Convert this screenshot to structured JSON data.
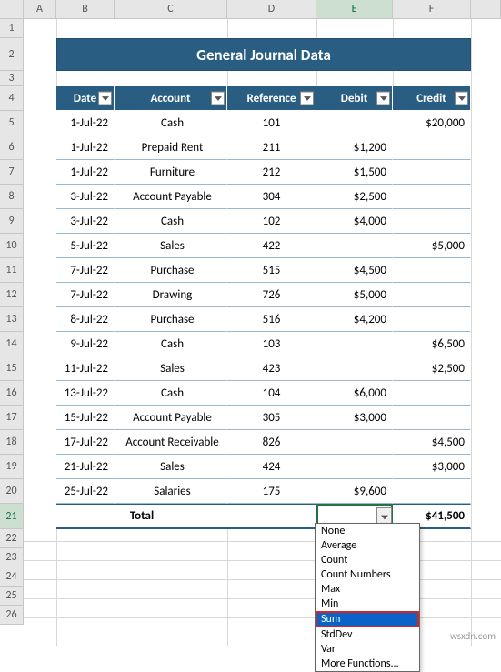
{
  "columns": [
    "",
    "A",
    "B",
    "C",
    "D",
    "E",
    "F",
    ""
  ],
  "active_column": "E",
  "rows": [
    "1",
    "2",
    "3",
    "4",
    "5",
    "6",
    "7",
    "8",
    "9",
    "10",
    "11",
    "12",
    "13",
    "14",
    "15",
    "16",
    "17",
    "18",
    "19",
    "20",
    "21",
    "22",
    "23",
    "24",
    "25",
    "26"
  ],
  "active_row": "21",
  "title": "General Journal Data",
  "headers": {
    "date": "Date",
    "account": "Account",
    "reference": "Reference",
    "debit": "Debit",
    "credit": "Credit"
  },
  "data": [
    {
      "date": "1-Jul-22",
      "account": "Cash",
      "reference": "101",
      "debit": "",
      "credit": "$20,000"
    },
    {
      "date": "1-Jul-22",
      "account": "Prepaid Rent",
      "reference": "211",
      "debit": "$1,200",
      "credit": ""
    },
    {
      "date": "1-Jul-22",
      "account": "Furniture",
      "reference": "212",
      "debit": "$1,500",
      "credit": ""
    },
    {
      "date": "3-Jul-22",
      "account": "Account Payable",
      "reference": "304",
      "debit": "$2,500",
      "credit": ""
    },
    {
      "date": "3-Jul-22",
      "account": "Cash",
      "reference": "102",
      "debit": "$4,000",
      "credit": ""
    },
    {
      "date": "5-Jul-22",
      "account": "Sales",
      "reference": "422",
      "debit": "",
      "credit": "$5,000"
    },
    {
      "date": "7-Jul-22",
      "account": "Purchase",
      "reference": "515",
      "debit": "$4,500",
      "credit": ""
    },
    {
      "date": "7-Jul-22",
      "account": "Drawing",
      "reference": "726",
      "debit": "$5,000",
      "credit": ""
    },
    {
      "date": "8-Jul-22",
      "account": "Purchase",
      "reference": "516",
      "debit": "$4,200",
      "credit": ""
    },
    {
      "date": "9-Jul-22",
      "account": "Cash",
      "reference": "103",
      "debit": "",
      "credit": "$6,500"
    },
    {
      "date": "11-Jul-22",
      "account": "Sales",
      "reference": "423",
      "debit": "",
      "credit": "$2,500"
    },
    {
      "date": "13-Jul-22",
      "account": "Cash",
      "reference": "104",
      "debit": "$6,000",
      "credit": ""
    },
    {
      "date": "15-Jul-22",
      "account": "Account Payable",
      "reference": "305",
      "debit": "$3,000",
      "credit": ""
    },
    {
      "date": "17-Jul-22",
      "account": "Account Receivable",
      "reference": "826",
      "debit": "",
      "credit": "$4,500"
    },
    {
      "date": "21-Jul-22",
      "account": "Sales",
      "reference": "424",
      "debit": "",
      "credit": "$3,000"
    },
    {
      "date": "25-Jul-22",
      "account": "Salaries",
      "reference": "175",
      "debit": "$9,600",
      "credit": ""
    }
  ],
  "total": {
    "label": "Total",
    "debit": "",
    "credit": "$41,500"
  },
  "dropdown": {
    "options": [
      "None",
      "Average",
      "Count",
      "Count Numbers",
      "Max",
      "Min",
      "Sum",
      "StdDev",
      "Var",
      "More Functions..."
    ],
    "selected": "Sum"
  },
  "watermark": "wsxdn.com"
}
